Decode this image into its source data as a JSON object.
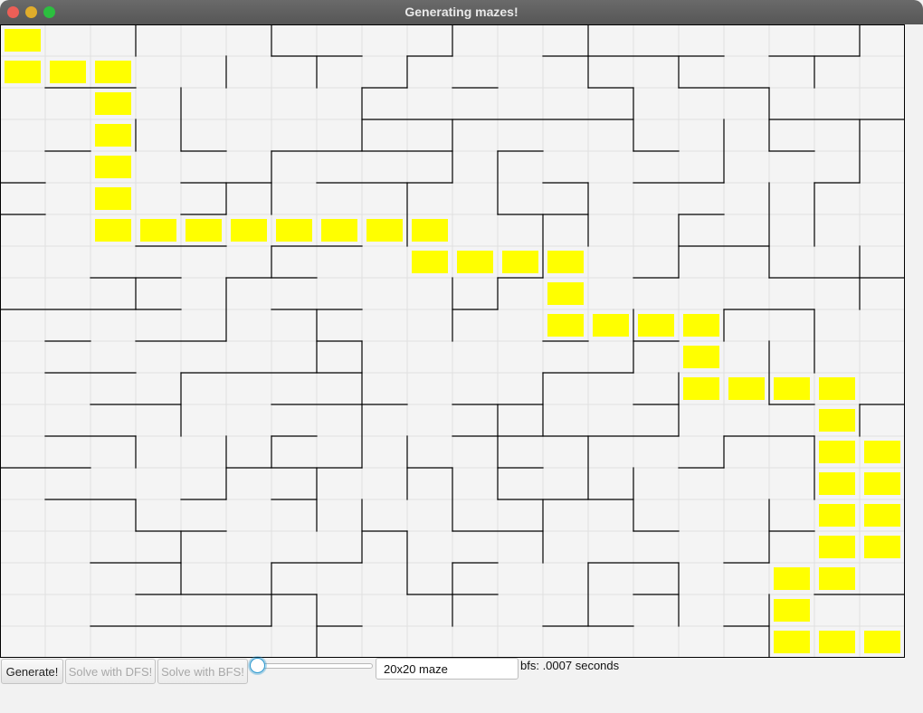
{
  "window": {
    "title": "Generating mazes!",
    "traffic_lights": {
      "close": "#ec5f57",
      "minimize": "#e0ad2b",
      "maximize": "#2cbf3f"
    }
  },
  "maze": {
    "rows": 20,
    "cols": 20,
    "path_color": "#ffff00",
    "wall_color": "#000000",
    "grid_color": "#e0e0e0",
    "solution_cells": [
      [
        0,
        0
      ],
      [
        1,
        0
      ],
      [
        1,
        1
      ],
      [
        1,
        2
      ],
      [
        2,
        2
      ],
      [
        3,
        2
      ],
      [
        4,
        2
      ],
      [
        5,
        2
      ],
      [
        6,
        2
      ],
      [
        6,
        3
      ],
      [
        6,
        4
      ],
      [
        6,
        5
      ],
      [
        6,
        6
      ],
      [
        6,
        7
      ],
      [
        6,
        8
      ],
      [
        6,
        9
      ],
      [
        7,
        9
      ],
      [
        7,
        10
      ],
      [
        7,
        11
      ],
      [
        7,
        12
      ],
      [
        8,
        12
      ],
      [
        9,
        12
      ],
      [
        9,
        13
      ],
      [
        9,
        14
      ],
      [
        9,
        15
      ],
      [
        10,
        15
      ],
      [
        11,
        15
      ],
      [
        11,
        16
      ],
      [
        11,
        17
      ],
      [
        11,
        18
      ],
      [
        12,
        18
      ],
      [
        13,
        18
      ],
      [
        13,
        19
      ],
      [
        14,
        18
      ],
      [
        14,
        19
      ],
      [
        15,
        18
      ],
      [
        15,
        19
      ],
      [
        16,
        18
      ],
      [
        16,
        19
      ],
      [
        17,
        17
      ],
      [
        17,
        18
      ],
      [
        18,
        17
      ],
      [
        19,
        17
      ],
      [
        19,
        18
      ],
      [
        19,
        19
      ]
    ],
    "walls_h": [
      [
        1,
        6,
        8
      ],
      [
        1,
        9,
        10
      ],
      [
        1,
        12,
        16
      ],
      [
        1,
        17,
        19
      ],
      [
        2,
        1,
        3
      ],
      [
        2,
        8,
        9
      ],
      [
        2,
        10,
        11
      ],
      [
        2,
        13,
        14
      ],
      [
        2,
        15,
        17
      ],
      [
        3,
        8,
        14
      ],
      [
        3,
        17,
        20
      ],
      [
        4,
        1,
        2
      ],
      [
        4,
        4,
        5
      ],
      [
        4,
        6,
        10
      ],
      [
        4,
        11,
        12
      ],
      [
        4,
        14,
        15
      ],
      [
        4,
        17,
        18
      ],
      [
        5,
        0,
        1
      ],
      [
        5,
        4,
        6
      ],
      [
        5,
        7,
        10
      ],
      [
        5,
        12,
        13
      ],
      [
        5,
        14,
        16
      ],
      [
        5,
        18,
        19
      ],
      [
        6,
        0,
        1
      ],
      [
        6,
        4,
        5
      ],
      [
        6,
        11,
        13
      ],
      [
        6,
        15,
        16
      ],
      [
        7,
        3,
        5
      ],
      [
        7,
        6,
        8
      ],
      [
        7,
        15,
        17
      ],
      [
        8,
        2,
        4
      ],
      [
        8,
        5,
        7
      ],
      [
        8,
        11,
        12
      ],
      [
        8,
        14,
        15
      ],
      [
        8,
        17,
        20
      ],
      [
        9,
        0,
        4
      ],
      [
        9,
        6,
        8
      ],
      [
        9,
        10,
        11
      ],
      [
        9,
        16,
        18
      ],
      [
        10,
        1,
        2
      ],
      [
        10,
        3,
        5
      ],
      [
        10,
        7,
        8
      ],
      [
        10,
        12,
        13
      ],
      [
        10,
        14,
        15
      ],
      [
        11,
        1,
        3
      ],
      [
        11,
        4,
        8
      ],
      [
        11,
        12,
        14
      ],
      [
        12,
        2,
        4
      ],
      [
        12,
        6,
        9
      ],
      [
        12,
        10,
        12
      ],
      [
        12,
        14,
        15
      ],
      [
        12,
        17,
        18
      ],
      [
        12,
        19,
        20
      ],
      [
        13,
        1,
        3
      ],
      [
        13,
        6,
        7
      ],
      [
        13,
        10,
        15
      ],
      [
        13,
        16,
        18
      ],
      [
        14,
        0,
        2
      ],
      [
        14,
        5,
        8
      ],
      [
        14,
        9,
        10
      ],
      [
        14,
        11,
        12
      ],
      [
        14,
        15,
        16
      ],
      [
        15,
        1,
        3
      ],
      [
        15,
        4,
        5
      ],
      [
        15,
        6,
        7
      ],
      [
        15,
        11,
        14
      ],
      [
        16,
        3,
        5
      ],
      [
        16,
        8,
        9
      ],
      [
        16,
        10,
        12
      ],
      [
        16,
        14,
        15
      ],
      [
        16,
        17,
        18
      ],
      [
        17,
        2,
        4
      ],
      [
        17,
        6,
        8
      ],
      [
        17,
        10,
        11
      ],
      [
        17,
        13,
        15
      ],
      [
        17,
        16,
        17
      ],
      [
        18,
        3,
        7
      ],
      [
        18,
        9,
        11
      ],
      [
        18,
        14,
        15
      ],
      [
        18,
        18,
        20
      ],
      [
        19,
        2,
        6
      ],
      [
        19,
        7,
        8
      ],
      [
        19,
        12,
        14
      ],
      [
        19,
        16,
        17
      ]
    ],
    "walls_v": [
      [
        3,
        0,
        1
      ],
      [
        3,
        3,
        4
      ],
      [
        3,
        8,
        9
      ],
      [
        3,
        13,
        14
      ],
      [
        3,
        15,
        16
      ],
      [
        4,
        2,
        4
      ],
      [
        4,
        11,
        13
      ],
      [
        4,
        16,
        18
      ],
      [
        5,
        1,
        2
      ],
      [
        5,
        5,
        6
      ],
      [
        5,
        8,
        10
      ],
      [
        5,
        13,
        15
      ],
      [
        6,
        0,
        1
      ],
      [
        6,
        4,
        6
      ],
      [
        6,
        7,
        8
      ],
      [
        6,
        13,
        14
      ],
      [
        6,
        17,
        19
      ],
      [
        7,
        1,
        2
      ],
      [
        7,
        9,
        11
      ],
      [
        7,
        14,
        16
      ],
      [
        7,
        18,
        20
      ],
      [
        8,
        2,
        4
      ],
      [
        8,
        10,
        12
      ],
      [
        8,
        12,
        14
      ],
      [
        8,
        15,
        17
      ],
      [
        9,
        1,
        2
      ],
      [
        9,
        5,
        7
      ],
      [
        9,
        13,
        15
      ],
      [
        9,
        16,
        18
      ],
      [
        10,
        0,
        1
      ],
      [
        10,
        3,
        5
      ],
      [
        10,
        8,
        10
      ],
      [
        10,
        14,
        16
      ],
      [
        10,
        17,
        19
      ],
      [
        11,
        4,
        6
      ],
      [
        11,
        8,
        9
      ],
      [
        11,
        12,
        15
      ],
      [
        12,
        6,
        8
      ],
      [
        12,
        11,
        13
      ],
      [
        12,
        15,
        17
      ],
      [
        13,
        0,
        2
      ],
      [
        13,
        5,
        7
      ],
      [
        13,
        13,
        15
      ],
      [
        13,
        17,
        19
      ],
      [
        14,
        2,
        4
      ],
      [
        14,
        9,
        11
      ],
      [
        14,
        14,
        16
      ],
      [
        15,
        1,
        2
      ],
      [
        15,
        6,
        8
      ],
      [
        15,
        11,
        13
      ],
      [
        15,
        17,
        19
      ],
      [
        16,
        3,
        5
      ],
      [
        16,
        9,
        10
      ],
      [
        16,
        13,
        14
      ],
      [
        17,
        2,
        4
      ],
      [
        17,
        5,
        8
      ],
      [
        17,
        10,
        12
      ],
      [
        17,
        15,
        17
      ],
      [
        17,
        18,
        20
      ],
      [
        18,
        1,
        2
      ],
      [
        18,
        5,
        7
      ],
      [
        18,
        9,
        11
      ],
      [
        18,
        13,
        15
      ],
      [
        19,
        0,
        1
      ],
      [
        19,
        3,
        5
      ],
      [
        19,
        7,
        9
      ],
      [
        19,
        12,
        13
      ]
    ]
  },
  "toolbar": {
    "generate_label": "Generate!",
    "dfs_label": "Solve with DFS!",
    "bfs_label": "Solve with BFS!",
    "slider_value": 0,
    "size_value": "20x20 maze",
    "status_text": "bfs: .0007 seconds"
  }
}
